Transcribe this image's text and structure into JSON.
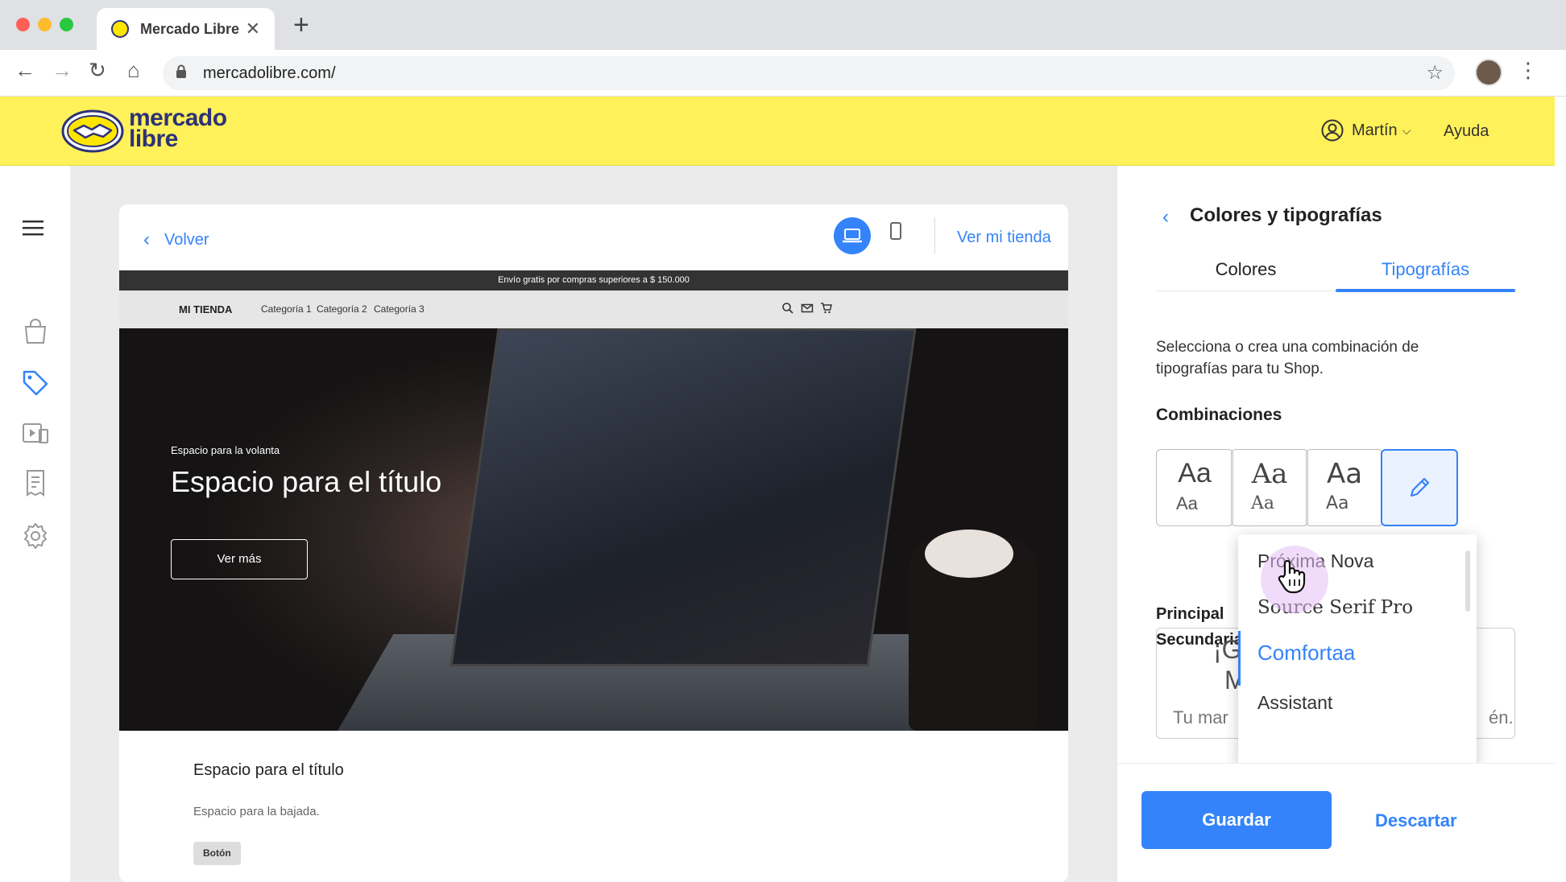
{
  "browser": {
    "tab_title": "Mercado Libre",
    "url": "mercadolibre.com/"
  },
  "header": {
    "logo_line1": "mercado",
    "logo_line2": "libre",
    "user_name": "Martín",
    "help": "Ayuda"
  },
  "editor": {
    "back_label": "Volver",
    "view_store": "Ver mi tienda"
  },
  "store": {
    "promo": "Envío gratis por compras superiores a $ 150.000",
    "brand": "MI TIENDA",
    "categories": [
      "Categoría 1",
      "Categoría 2",
      "Categoría 3"
    ],
    "hero": {
      "volanta": "Espacio para la volanta",
      "title": "Espacio para el título",
      "button": "Ver más"
    },
    "section": {
      "title": "Espacio para el título",
      "subtitle": "Espacio para la bajada.",
      "button": "Botón"
    }
  },
  "panel": {
    "title": "Colores y tipografías",
    "tabs": [
      "Colores",
      "Tipografías"
    ],
    "active_tab": "Tipografías",
    "description": "Selecciona o crea una combinación de tipografías para tu Shop.",
    "combinations_label": "Combinaciones",
    "combos": [
      {
        "big": "Aa",
        "small": "Aa"
      },
      {
        "big": "Aa",
        "small": "Aa"
      },
      {
        "big": "Aa",
        "small": "Aa"
      }
    ],
    "principal_label": "Principal",
    "secundaria_label": "Secundaria",
    "preview": {
      "line1": "¡G",
      "line2": "M",
      "line3": "Tu mar",
      "line4": "én."
    },
    "font_options": [
      "Próxima Nova",
      "Source Serif Pro",
      "Comfortaa",
      "Assistant"
    ],
    "selected_font": "Comfortaa",
    "save": "Guardar",
    "discard": "Descartar"
  },
  "colors": {
    "accent": "#3483fa",
    "header_yellow": "#fff159"
  }
}
